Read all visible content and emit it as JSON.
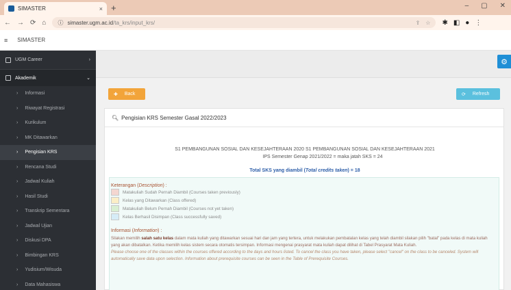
{
  "browser": {
    "tab_title": "SIMASTER",
    "tab_close": "×",
    "new_tab": "+",
    "url_host": "simaster.ugm.ac.id",
    "url_path": "/ta_krs/input_krs/",
    "win_min": "–",
    "win_max": "▢",
    "win_close": "✕"
  },
  "header": {
    "title": "SIMASTER",
    "menu_icon": "≡"
  },
  "sidebar": {
    "career": "UGM Career",
    "group": "Akademik",
    "items": [
      "Informasi",
      "Riwayat Registrasi",
      "Kurikulum",
      "MK Ditawarkan",
      "Pengisian KRS",
      "Rencana Studi",
      "Jadwal Kuliah",
      "Hasil Studi",
      "Transkrip Sementara",
      "Jadwal Ujian",
      "Diskusi DPA",
      "Bimbingan KRS",
      "Yudisium/Wisuda",
      "Data Mahasiswa"
    ],
    "active_index": 4
  },
  "buttons": {
    "back": "Back",
    "refresh": "Refresh"
  },
  "panel": {
    "heading": "Pengisian KRS Semester Gasal 2022/2023",
    "program_line": "S1 PEMBANGUNAN SOSIAL DAN KESEJAHTERAAN   2020     S1 PEMBANGUNAN SOSIAL DAN KESEJAHTERAAN 2021",
    "ips_line": "IPS Semester Genap 2021/2022 =          maka jatah SKS = 24",
    "total_prefix": "Total SKS yang diambil (",
    "total_italic": "Total credits taken",
    "total_suffix": ") = 18"
  },
  "legend": {
    "title": "Keterangan (",
    "title_italic": "Description",
    "title_suffix": ") :",
    "rows": [
      {
        "label": "Matakuliah Sudah Pernah Diambil (Courses taken previously)",
        "color": "#f4d6d0"
      },
      {
        "label": "Kelas yang Ditawarkan (Class offered)",
        "color": "#fbeec6"
      },
      {
        "label": "Matakuliah Belum Pernah Diambil (Courses not yet taken)",
        "color": "#d8efd2"
      },
      {
        "label": "Kelas Berhasil Disimpan (Class successfully saved)",
        "color": "#d6ecf7"
      }
    ]
  },
  "info": {
    "title": "Informasi (",
    "title_italic": "Information",
    "title_suffix": ") :",
    "p1_prefix": "Silakan memilih ",
    "p1_bold": "salah satu kelas",
    "p1_rest": " dalam mata kuliah yang ditawarkan sesuai hari dan jam yang tertera, untuk melakukan pembatalan kelas yang telah diambil silakan pilih \"batal\" pada kelas di mata kuliah yang akan dibatalkan. Ketika memilih kelas sistem secara otomatis tersimpan. Informasi mengenai prasyarat mata kuliah dapat dilihat di Tabel Prasyarat Mata Kuliah.",
    "p2": "Please choose one of the classes within the courses offered according to the days and hours listed. To cancel the class you have taken, please select \"cancel\" on the class to be canceled. System will automatically save data upon selection. Information about prerequisite courses can be seen in the Table of Prerequisite Courses."
  },
  "colors": {
    "sidebar_bg": "#2c2f34",
    "back_button": "#f2a43a",
    "refresh_button": "#5bc0de",
    "accent": "#1f8fd6"
  }
}
